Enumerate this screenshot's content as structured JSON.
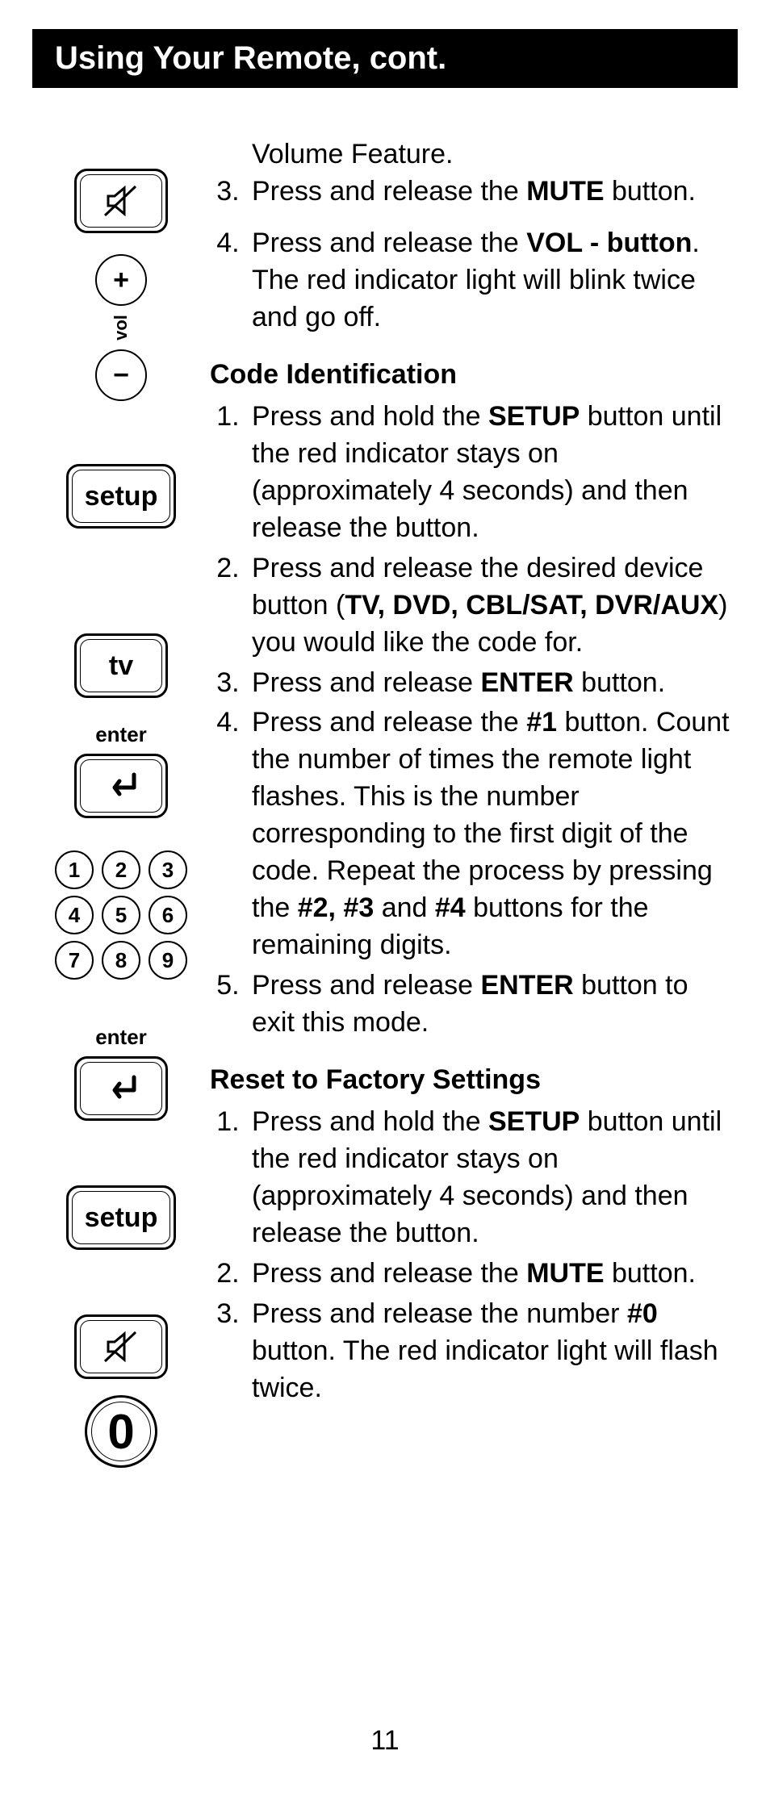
{
  "header": "Using Your Remote, cont.",
  "pageNumber": "11",
  "left": {
    "setup": "setup",
    "tv": "tv",
    "enter": "enter",
    "vol": "vol",
    "keys": [
      "1",
      "2",
      "3",
      "4",
      "5",
      "6",
      "7",
      "8",
      "9"
    ],
    "zero": "0",
    "plus": "+",
    "minus": "−"
  },
  "text": {
    "volFeature": "Volume Feature.",
    "s3_pre": "Press and release the ",
    "s3_b": "MUTE",
    "s3_post": " button.",
    "s4_pre": "Press and release the ",
    "s4_b": "VOL - button",
    "s4_post": ". The red indicator light will blink twice and go off.",
    "codeId": "Code Identification",
    "c1_pre": "Press and hold the ",
    "c1_b": "SETUP",
    "c1_post": " button until the red indicator stays on (approximately 4 seconds) and then release the button.",
    "c2_pre": "Press and release the desired device button (",
    "c2_b": "TV, DVD, CBL/SAT, DVR/AUX",
    "c2_post": ") you would like the code for.",
    "c3_pre": "Press and release ",
    "c3_b": "ENTER",
    "c3_post": " button.",
    "c4_pre": "Press and release the ",
    "c4_b1": "#1",
    "c4_mid1": " button. Count the number of times the remote light flashes. This is the number corresponding to the first digit of the code. Repeat the process by pressing the ",
    "c4_b2": "#2, #3",
    "c4_mid2": " and ",
    "c4_b3": "#4",
    "c4_post": " buttons for the remaining digits.",
    "c5_pre": "Press and release ",
    "c5_b": "ENTER",
    "c5_post": " button to exit this mode.",
    "reset": "Reset to Factory Settings",
    "r1_pre": "Press and hold the ",
    "r1_b": "SETUP",
    "r1_post": " button until the red indicator stays on (approximately 4 seconds) and then release the button.",
    "r2_pre": "Press and release the ",
    "r2_b": "MUTE",
    "r2_post": " button.",
    "r3_pre": "Press and release the number ",
    "r3_b": "#0",
    "r3_post": " button. The red indicator light will flash twice."
  }
}
